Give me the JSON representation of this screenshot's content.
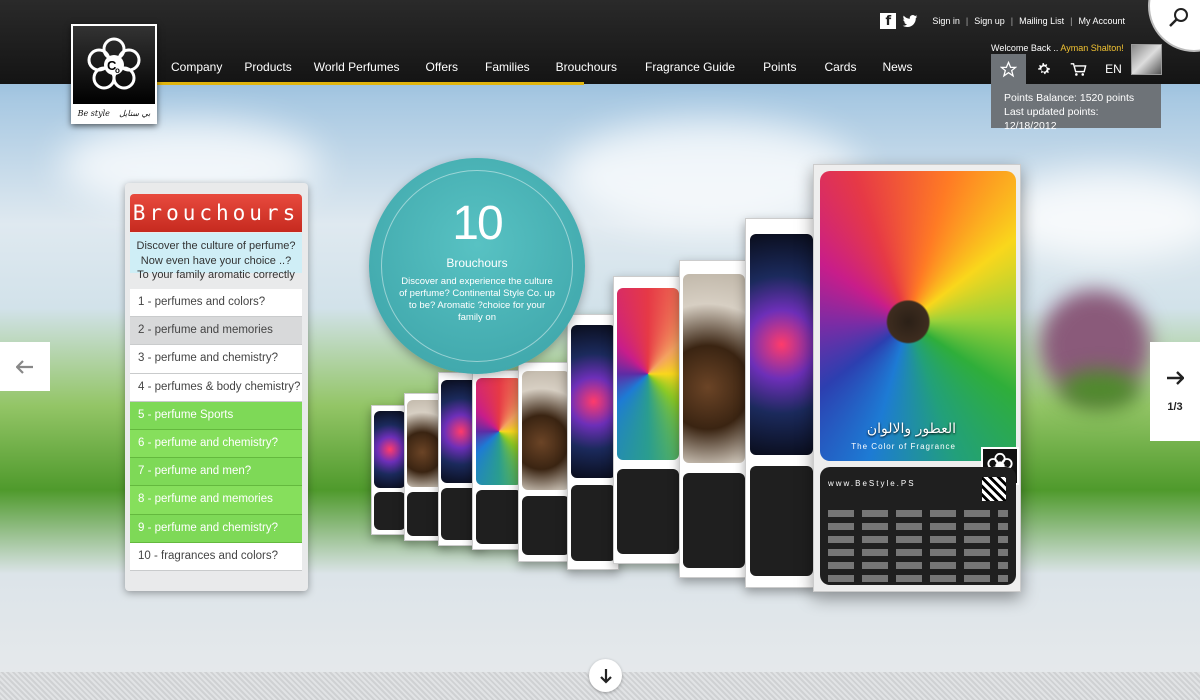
{
  "nav": {
    "items": [
      "Company",
      "Products",
      "World Perfumes",
      "Offers",
      "Families",
      "Brouchours",
      "Fragrance Guide",
      "Points",
      "Cards",
      "News"
    ]
  },
  "logo": {
    "tagline_left": "Be style",
    "tagline_right": "بي ستايل"
  },
  "toplinks": {
    "sign_in": "Sign in",
    "sign_up": "Sign up",
    "mailing_list": "Mailing List",
    "my_account": "My Account",
    "separator": "|"
  },
  "user": {
    "welcome_prefix": "Welcome Back .. ",
    "name": "Ayman Shalton!"
  },
  "iconbar": {
    "language": "EN"
  },
  "points": {
    "balance": "Points Balance: 1520 points",
    "updated": "Last updated points: 12/18/2012"
  },
  "panel": {
    "title": "Brouchours",
    "intro_line1": "Discover the culture of perfume?",
    "intro_line2": "Now even have your choice ..?",
    "intro_line3": "To your family aromatic correctly",
    "items": [
      "1 - perfumes and colors?",
      "2 - perfume and memories",
      "3 - perfume and chemistry?",
      "4 - perfumes & body chemistry?",
      "5 - perfume Sports",
      "6 - perfume and chemistry?",
      "7 - perfume and men?",
      "8 - perfume and memories",
      "9 - perfume and chemistry?",
      "10 - fragrances and colors?"
    ]
  },
  "circle": {
    "count": "10",
    "label": "Brouchours",
    "desc": "Discover and experience the culture of perfume? Continental Style Co. up to be? Aromatic ?choice for your family on"
  },
  "brochure": {
    "arabic_title": "العطور والالوان",
    "subtitle": "The Color of Fragrance",
    "site": "www.BeStyle.PS"
  },
  "pager": {
    "page": "1/3"
  },
  "colors": {
    "accent_yellow": "#e0b40f",
    "header_red": "#d8342a",
    "active_green": "#7ed957",
    "teal": "#45b0b3"
  }
}
